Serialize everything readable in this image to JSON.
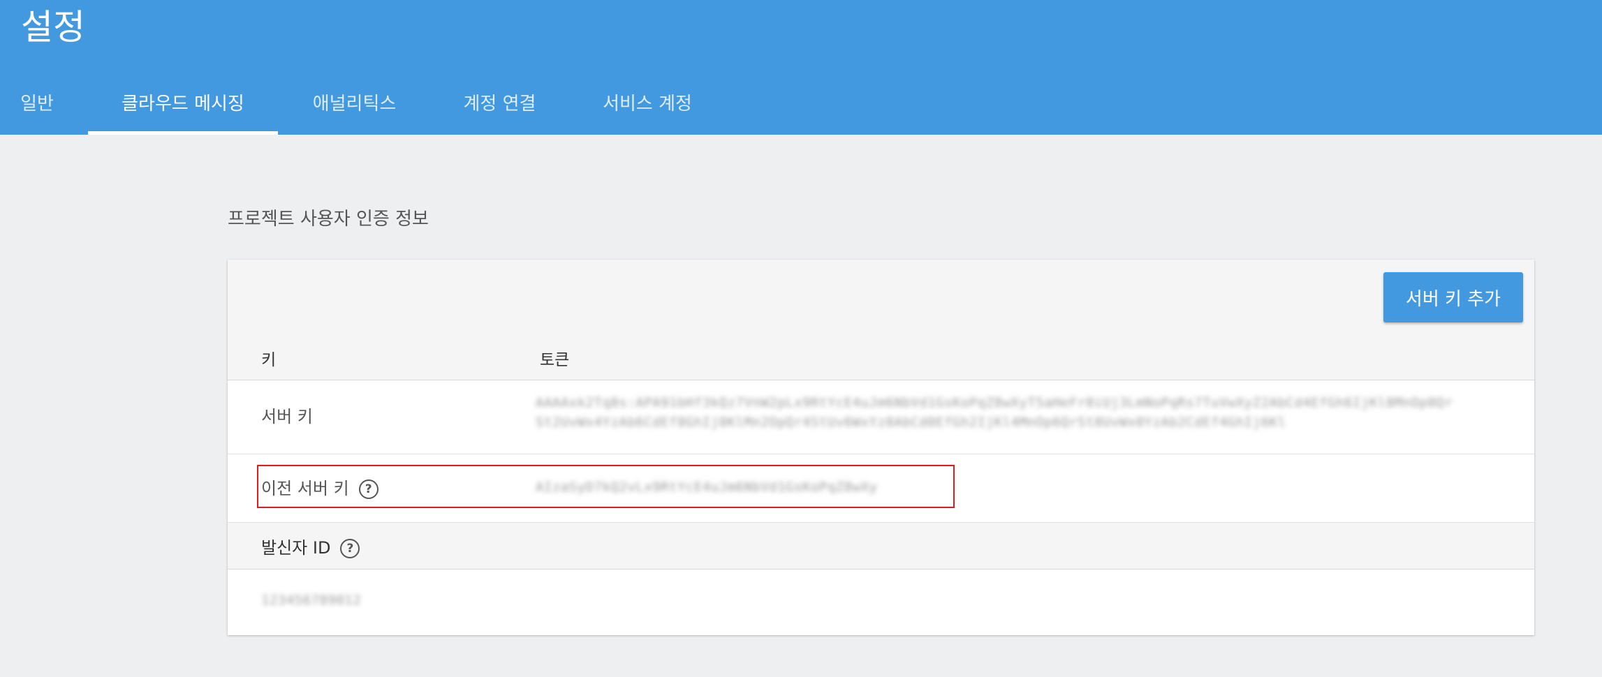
{
  "header": {
    "title": "설정",
    "tabs": [
      {
        "label": "일반",
        "active": false
      },
      {
        "label": "클라우드 메시징",
        "active": true
      },
      {
        "label": "애널리틱스",
        "active": false
      },
      {
        "label": "계정 연결",
        "active": false
      },
      {
        "label": "서비스 계정",
        "active": false
      }
    ]
  },
  "section": {
    "title": "프로젝트 사용자 인증 정보",
    "add_key_label": "서버 키 추가",
    "columns": {
      "key": "키",
      "token": "토큰"
    },
    "rows": {
      "server_key": {
        "label": "서버 키",
        "token_line1": "AAAAxk2Tq8s:APA91bHf3kQz7VnW2pLx9RtYcE4uJm6NbVd1GsKoPqZ8wXyT5aHeFr0iUj3LmNoPqRs7TuVwXyZ2AbCd4EfGh6IjKl8MnOp0Qr",
        "token_line2": "St2UvWx4YzAb6CdEf8GhIj0KlMn2OpQr4StUv6WxYz8AbCd0EfGh2IjKl4MnOp6QrSt8UvWx0YzAb2CdEf4GhIj6Kl"
      },
      "legacy_server_key": {
        "label": "이전 서버 키",
        "token": "AIzaSyD7kQ2vLx9RtYcE4uJm6NbVd1GsKoPqZ8wXy"
      },
      "sender_id": {
        "label": "발신자 ID",
        "value": "123456789012"
      }
    }
  },
  "colors": {
    "header_bg": "#4399e0",
    "page_bg": "#eeeff1",
    "highlight": "#e01b1b"
  },
  "icons": {
    "help": "question-circle-icon"
  }
}
